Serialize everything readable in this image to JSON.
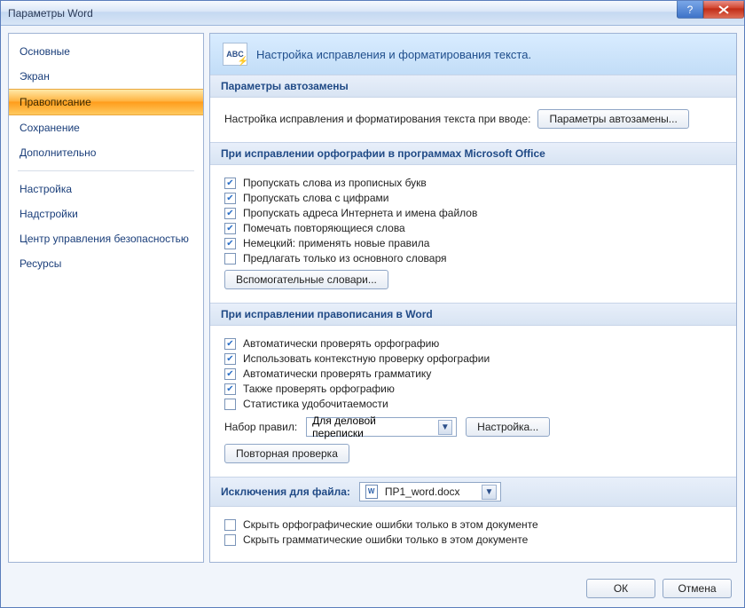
{
  "title": "Параметры Word",
  "banner": "Настройка исправления и форматирования текста.",
  "sidebar": {
    "items": [
      {
        "label": "Основные"
      },
      {
        "label": "Экран"
      },
      {
        "label": "Правописание",
        "selected": true
      },
      {
        "label": "Сохранение"
      },
      {
        "label": "Дополнительно"
      }
    ],
    "items2": [
      {
        "label": "Настройка"
      },
      {
        "label": "Надстройки"
      },
      {
        "label": "Центр управления безопасностью"
      },
      {
        "label": "Ресурсы"
      }
    ]
  },
  "g1": {
    "title": "Параметры автозамены",
    "desc": "Настройка исправления и форматирования текста при вводе:",
    "btn": "Параметры автозамены..."
  },
  "g2": {
    "title": "При исправлении орфографии в программах Microsoft Office",
    "c1": "Пропускать слова из прописных букв",
    "c2": "Пропускать слова с цифрами",
    "c3": "Пропускать адреса Интернета и имена файлов",
    "c4": "Помечать повторяющиеся слова",
    "c5": "Немецкий: применять новые правила",
    "c6": "Предлагать только из основного словаря",
    "btn": "Вспомогательные словари..."
  },
  "g3": {
    "title": "При исправлении правописания в Word",
    "c1": "Автоматически проверять орфографию",
    "c2": "Использовать контекстную проверку орфографии",
    "c3": "Автоматически проверять грамматику",
    "c4": "Также проверять орфографию",
    "c5": "Статистика удобочитаемости",
    "rulesLabel": "Набор правил:",
    "rulesValue": "Для деловой переписки",
    "rulesBtn": "Настройка...",
    "recheckBtn": "Повторная проверка"
  },
  "g4": {
    "title": "Исключения для файла:",
    "file": "ПР1_word.docx",
    "c1": "Скрыть орфографические ошибки только в этом документе",
    "c2": "Скрыть грамматические ошибки только в этом документе"
  },
  "footer": {
    "ok": "ОК",
    "cancel": "Отмена"
  }
}
